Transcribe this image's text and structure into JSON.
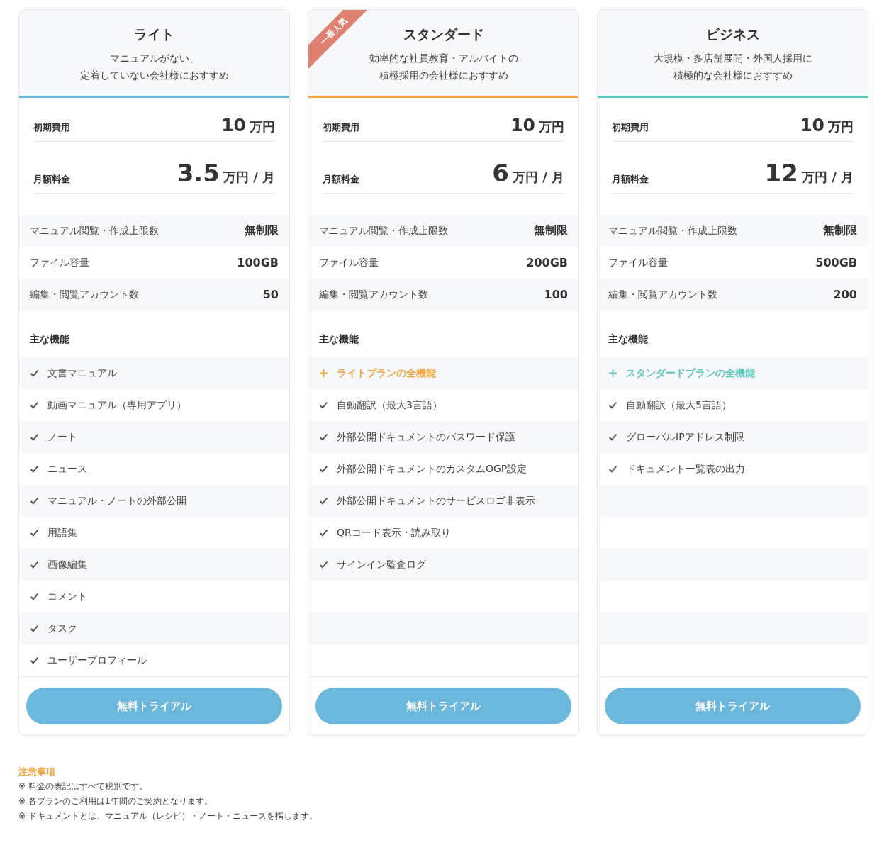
{
  "plans": [
    {
      "name": "ライト",
      "description": [
        "マニュアルがない、",
        "定着していない会社様におすすめ"
      ],
      "color": "#6bb5db",
      "initial_fee": {
        "label": "初期費用",
        "amount": "10",
        "unit": "万円"
      },
      "monthly_fee": {
        "label": "月額料金",
        "amount": "3.5",
        "unit": "万円 / 月"
      },
      "specs": [
        {
          "label": "マニュアル閲覧・作成上限数",
          "value": "無制限"
        },
        {
          "label": "ファイル容量",
          "value": "100GB"
        },
        {
          "label": "編集・閲覧アカウント数",
          "value": "50"
        }
      ],
      "features_title": "主な機能",
      "features": [
        {
          "kind": "check",
          "text": "文書マニュアル"
        },
        {
          "kind": "check",
          "text": "動画マニュアル（専用アプリ）"
        },
        {
          "kind": "check",
          "text": "ノート"
        },
        {
          "kind": "check",
          "text": "ニュース"
        },
        {
          "kind": "check",
          "text": "マニュアル・ノートの外部公開"
        },
        {
          "kind": "check",
          "text": "用語集"
        },
        {
          "kind": "check",
          "text": "画像編集"
        },
        {
          "kind": "check",
          "text": "コメント"
        },
        {
          "kind": "check",
          "text": "タスク"
        },
        {
          "kind": "check",
          "text": "ユーザープロフィール"
        }
      ],
      "button": "無料トライアル"
    },
    {
      "name": "スタンダード",
      "badge": "一番人気",
      "description": [
        "効率的な社員教育・アルバイトの",
        "積極採用の会社様におすすめ"
      ],
      "color": "#f0a53a",
      "initial_fee": {
        "label": "初期費用",
        "amount": "10",
        "unit": "万円"
      },
      "monthly_fee": {
        "label": "月額料金",
        "amount": "6",
        "unit": "万円 / 月"
      },
      "specs": [
        {
          "label": "マニュアル閲覧・作成上限数",
          "value": "無制限"
        },
        {
          "label": "ファイル容量",
          "value": "200GB"
        },
        {
          "label": "編集・閲覧アカウント数",
          "value": "100"
        }
      ],
      "features_title": "主な機能",
      "features": [
        {
          "kind": "plus",
          "text": "ライトプランの全機能"
        },
        {
          "kind": "check",
          "text": "自動翻訳（最大3言語）"
        },
        {
          "kind": "check",
          "text": "外部公開ドキュメントのパスワード保護"
        },
        {
          "kind": "check",
          "text": "外部公開ドキュメントのカスタムOGP設定"
        },
        {
          "kind": "check",
          "text": "外部公開ドキュメントのサービスロゴ非表示"
        },
        {
          "kind": "check",
          "text": "QRコード表示・読み取り"
        },
        {
          "kind": "check",
          "text": "サインイン監査ログ"
        }
      ],
      "button": "無料トライアル"
    },
    {
      "name": "ビジネス",
      "description": [
        "大規模・多店舗展開・外国人採用に",
        "積極的な会社様におすすめ"
      ],
      "color": "#5cc8bd",
      "initial_fee": {
        "label": "初期費用",
        "amount": "10",
        "unit": "万円"
      },
      "monthly_fee": {
        "label": "月額料金",
        "amount": "12",
        "unit": "万円 / 月"
      },
      "specs": [
        {
          "label": "マニュアル閲覧・作成上限数",
          "value": "無制限"
        },
        {
          "label": "ファイル容量",
          "value": "500GB"
        },
        {
          "label": "編集・閲覧アカウント数",
          "value": "200"
        }
      ],
      "features_title": "主な機能",
      "features": [
        {
          "kind": "plus",
          "text": "スタンダードプランの全機能"
        },
        {
          "kind": "check",
          "text": "自動翻訳（最大5言語）"
        },
        {
          "kind": "check",
          "text": "グローバルIPアドレス制限"
        },
        {
          "kind": "check",
          "text": "ドキュメント一覧表の出力"
        }
      ],
      "button": "無料トライアル"
    }
  ],
  "notes": {
    "title": "注意事項",
    "items": [
      "※ 料金の表記はすべて税別です。",
      "※ 各プランのご利用は1年間のご契約となります。",
      "※ ドキュメントとは、マニュアル（レシピ）・ノート・ニュースを指します。"
    ]
  }
}
